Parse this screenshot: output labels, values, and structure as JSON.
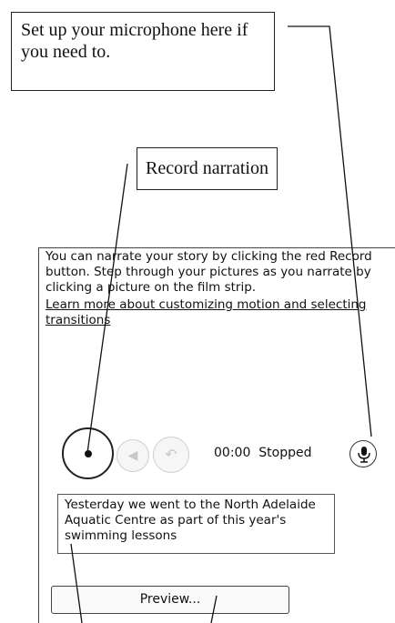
{
  "callouts": {
    "mic_setup": "Set up your microphone here if you need to.",
    "record_narration": "Record narration"
  },
  "panel": {
    "instructions": "You can narrate your story by clicking the red Record button. Step through your pictures as you narrate by clicking a picture on the film strip.",
    "learn_more_link": "Learn more about customizing motion and selecting transitions",
    "status_time": "00:00",
    "status_text": "Stopped",
    "narration_text": "Yesterday we went to the North Adelaide Aquatic Centre as part of this year's swimming lessons",
    "preview_button": "Preview..."
  },
  "icons": {
    "record": "record-icon",
    "previous": "previous-icon",
    "undo": "undo-icon",
    "microphone": "microphone-icon"
  },
  "colors": {
    "accent": "#111111",
    "disabled": "#c8c8c8"
  }
}
